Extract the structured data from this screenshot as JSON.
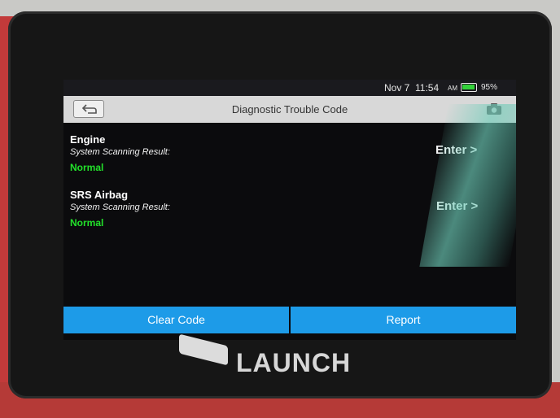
{
  "status_bar": {
    "date": "Nov 7",
    "time": "11:54",
    "am_pm": "AM",
    "battery": "95%",
    "battery_color": "#33d13a"
  },
  "header": {
    "title": "Diagnostic Trouble Code",
    "back_icon": "back-arrow-icon",
    "camera_icon": "camera-icon"
  },
  "systems": [
    {
      "name": "Engine",
      "result_label": "System Scanning Result:",
      "status": "Normal",
      "enter_label": "Enter >"
    },
    {
      "name": "SRS Airbag",
      "result_label": "System Scanning Result:",
      "status": "Normal",
      "enter_label": "Enter >"
    }
  ],
  "actions": {
    "clear_code_label": "Clear Code",
    "report_label": "Report",
    "button_color": "#1d9be8"
  },
  "device": {
    "brand": "LAUNCH"
  }
}
